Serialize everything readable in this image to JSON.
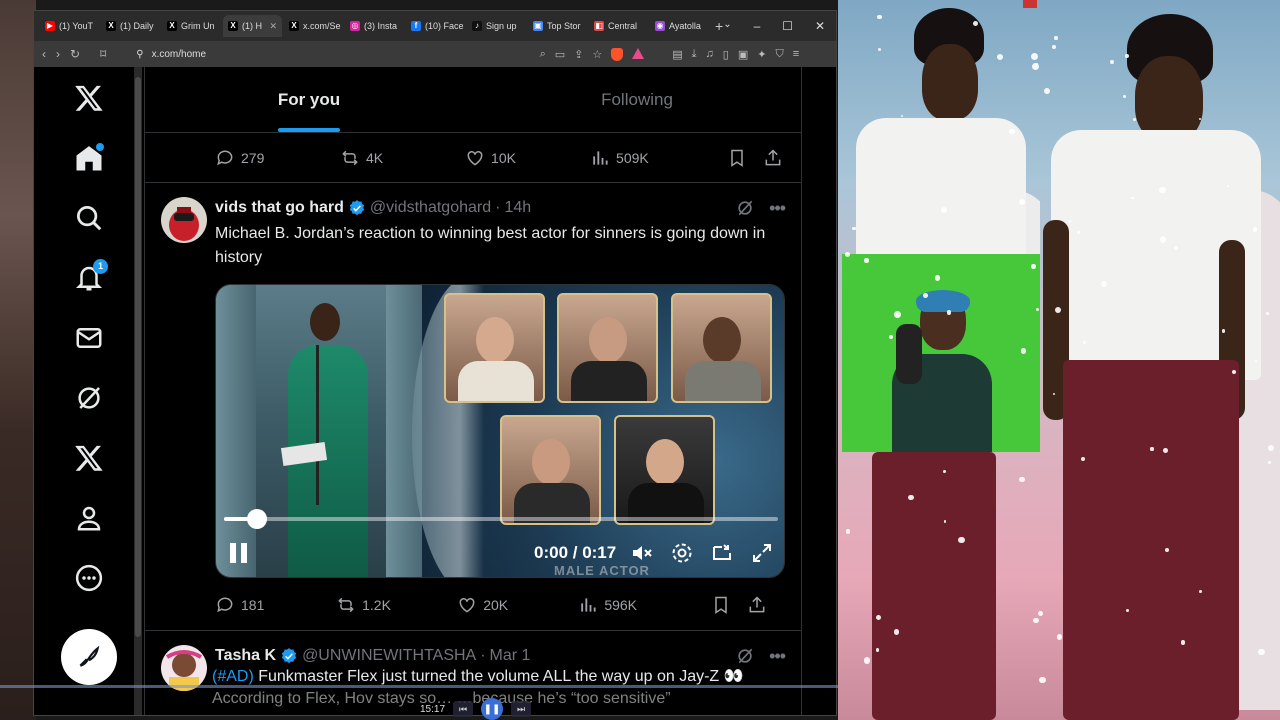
{
  "browser": {
    "tabs": [
      {
        "label": "(1) YouT",
        "color": "#ff0000",
        "glyph": "▶",
        "active": false
      },
      {
        "label": "(1) Daily",
        "color": "#000000",
        "glyph": "X",
        "active": false
      },
      {
        "label": "Grim Un",
        "color": "#000000",
        "glyph": "X",
        "active": false
      },
      {
        "label": "(1) H",
        "color": "#000000",
        "glyph": "X",
        "active": true
      },
      {
        "label": "x.com/Se",
        "color": "#000000",
        "glyph": "X",
        "active": false
      },
      {
        "label": "(3) Insta",
        "color": "#d6249f",
        "glyph": "◎",
        "active": false
      },
      {
        "label": "(10) Face",
        "color": "#1877f2",
        "glyph": "f",
        "active": false
      },
      {
        "label": "Sign up",
        "color": "#111111",
        "glyph": "♪",
        "active": false
      },
      {
        "label": "Top Stor",
        "color": "#4285f4",
        "glyph": "▣",
        "active": false
      },
      {
        "label": "Central",
        "color": "#e04848",
        "glyph": "◧",
        "active": false
      },
      {
        "label": "Ayatolla",
        "color": "#9a4bd6",
        "glyph": "◉",
        "active": false
      }
    ],
    "url": "x.com/home"
  },
  "x": {
    "tabs": {
      "for_you": "For you",
      "following": "Following"
    },
    "prev_tweet": {
      "replies": "279",
      "reposts": "4K",
      "likes": "10K",
      "views": "509K"
    },
    "tweet": {
      "name": "vids that go hard",
      "handle": "@vidsthatgohard",
      "dot": "·",
      "time": "14h",
      "text": "Michael B. Jordan’s reaction to winning best actor for sinners is going down in history",
      "video": {
        "timecode": "0:00 / 0:17",
        "caption": "MALE ACTOR",
        "progress": 0.06
      },
      "replies": "181",
      "reposts": "1.2K",
      "likes": "20K",
      "views": "596K"
    },
    "next_tweet": {
      "name": "Tasha K",
      "handle": "@UNWINEWITHTASHA",
      "dot": "·",
      "time": "Mar 1",
      "tag": "(#AD)",
      "text_rest": " Funkmaster Flex just turned the volume ALL the way up on Jay-Z 👀",
      "line2": "According to Flex, Hov stays so…  …because he’s “too sensitive”"
    },
    "notification_count": "1"
  },
  "media_player": {
    "time": "15:17"
  },
  "colors": {
    "accent": "#1d9bf0",
    "brave": "#fb542b"
  }
}
